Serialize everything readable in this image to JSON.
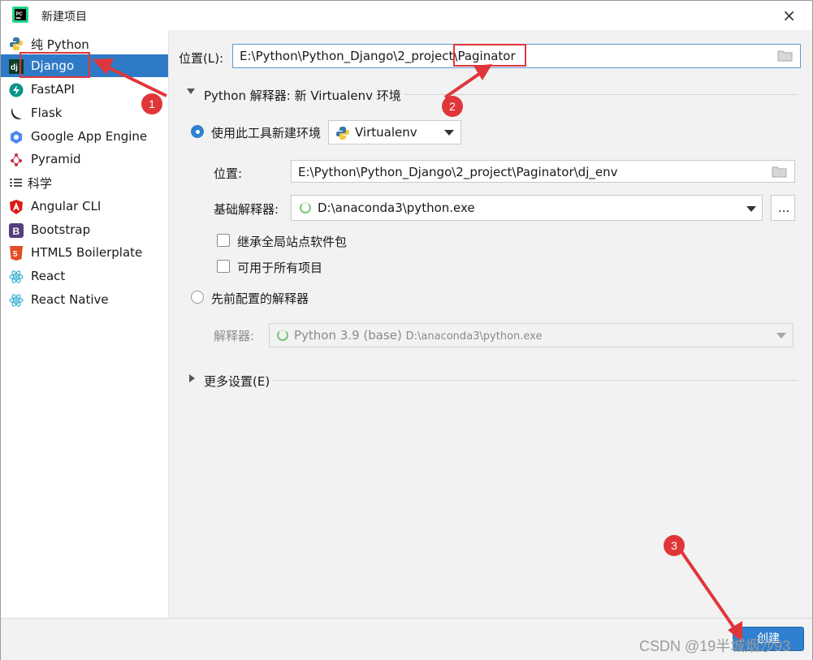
{
  "window": {
    "title": "新建项目",
    "close_icon": "×"
  },
  "sidebar": {
    "items": [
      {
        "label": "纯 Python",
        "icon": "python-icon"
      },
      {
        "label": "Django",
        "icon": "django-icon",
        "selected": true
      },
      {
        "label": "FastAPI",
        "icon": "fastapi-icon"
      },
      {
        "label": "Flask",
        "icon": "flask-icon"
      },
      {
        "label": "Google App Engine",
        "icon": "google-app-engine-icon"
      },
      {
        "label": "Pyramid",
        "icon": "pyramid-icon"
      },
      {
        "label": "科学",
        "icon": "scientific-icon"
      },
      {
        "label": "Angular CLI",
        "icon": "angular-icon"
      },
      {
        "label": "Bootstrap",
        "icon": "bootstrap-icon"
      },
      {
        "label": "HTML5 Boilerplate",
        "icon": "html5-icon"
      },
      {
        "label": "React",
        "icon": "react-icon"
      },
      {
        "label": "React Native",
        "icon": "react-icon"
      }
    ]
  },
  "location": {
    "label": "位置(L):",
    "path_prefix": "E:\\Python\\Python_Django\\2_project\\",
    "path_name": "Paginator"
  },
  "interpreter_section": {
    "title": "Python 解释器: 新 Virtualenv 环境",
    "new_env": {
      "label": "使用此工具新建环境",
      "tool": "Virtualenv",
      "location_label": "位置:",
      "location_value": "E:\\Python\\Python_Django\\2_project\\Paginator\\dj_env",
      "base_label": "基础解释器:",
      "base_value": "D:\\anaconda3\\python.exe",
      "browse_label": "...",
      "inherit_label": "继承全局站点软件包",
      "available_label": "可用于所有项目"
    },
    "existing": {
      "label": "先前配置的解释器",
      "interp_label": "解释器:",
      "interp_name": "Python 3.9 (base)",
      "interp_path": "D:\\anaconda3\\python.exe"
    }
  },
  "more_settings": {
    "label": "更多设置(E)"
  },
  "footer": {
    "create_label": "创建"
  },
  "annotations": {
    "badge_1": "1",
    "badge_2": "2",
    "badge_3": "3",
    "color": "#e0363a"
  },
  "watermark": "CSDN @19半城烟沙93"
}
